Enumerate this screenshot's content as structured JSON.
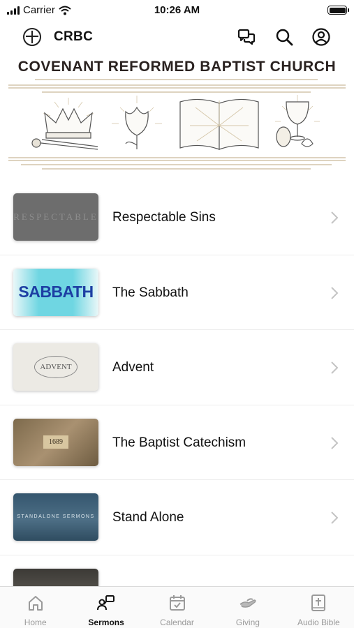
{
  "status_bar": {
    "carrier": "Carrier",
    "time": "10:26 AM"
  },
  "header": {
    "title": "CRBC"
  },
  "banner": {
    "title": "COVENANT REFORMED BAPTIST CHURCH"
  },
  "series": [
    {
      "label": "Respectable Sins",
      "thumb_text": "RESPECTABLE"
    },
    {
      "label": "The Sabbath",
      "thumb_text": "SABBATH"
    },
    {
      "label": "Advent",
      "thumb_text": "ADVENT"
    },
    {
      "label": "The Baptist Catechism",
      "thumb_text": "1689"
    },
    {
      "label": "Stand Alone",
      "thumb_text": "STANDALONE SERMONS"
    },
    {
      "label": "",
      "thumb_text": ""
    }
  ],
  "tabs": [
    {
      "label": "Home",
      "icon": "home-icon"
    },
    {
      "label": "Sermons",
      "icon": "sermons-icon"
    },
    {
      "label": "Calendar",
      "icon": "calendar-icon"
    },
    {
      "label": "Giving",
      "icon": "giving-icon"
    },
    {
      "label": "Audio Bible",
      "icon": "audio-bible-icon"
    }
  ],
  "colors": {
    "banner_gold": "#c9b99a",
    "active_tab": "#111111",
    "inactive_tab": "#9a9a9a"
  }
}
